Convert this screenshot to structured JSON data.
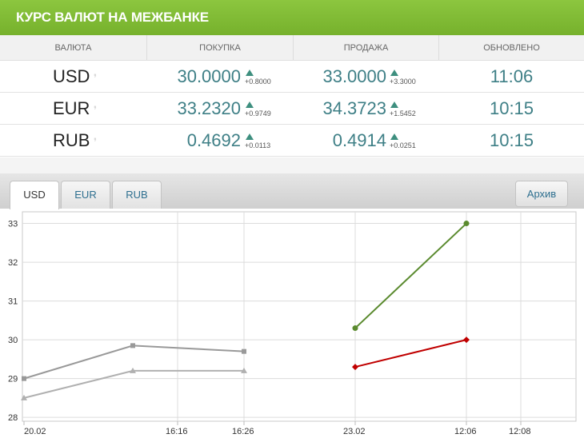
{
  "header": {
    "title": "КУРС ВАЛЮТ НА МЕЖБАНКЕ"
  },
  "table": {
    "headers": [
      "ВАЛЮТА",
      "ПОКУПКА",
      "ПРОДАЖА",
      "ОБНОВЛЕНО"
    ],
    "rows": [
      {
        "currency": "USD",
        "buy": "30.0000",
        "buy_delta": "+0.8000",
        "sell": "33.0000",
        "sell_delta": "+3.3000",
        "updated": "11:06"
      },
      {
        "currency": "EUR",
        "buy": "33.2320",
        "buy_delta": "+0.9749",
        "sell": "34.3723",
        "sell_delta": "+1.5452",
        "updated": "10:15"
      },
      {
        "currency": "RUB",
        "buy": "0.4692",
        "buy_delta": "+0.0113",
        "sell": "0.4914",
        "sell_delta": "+0.0251",
        "updated": "10:15"
      }
    ],
    "pin_icon": "pin-icon",
    "trend_icon": "triangle-up-icon",
    "accent_color": "#3e7f86"
  },
  "tabs": [
    {
      "label": "USD",
      "active": true
    },
    {
      "label": "EUR",
      "active": false
    },
    {
      "label": "RUB",
      "active": false
    }
  ],
  "archive_label": "Архив",
  "colors": {
    "header": "#7fbb33",
    "green_series": "#5a8a2e",
    "red_series": "#c00000",
    "gray_series": "#a0a0a0"
  },
  "chart_data": {
    "type": "line",
    "x_ticks": [
      "20.02",
      "16:16",
      "16:26",
      "23.02",
      "12:06",
      "12:08"
    ],
    "y_ticks": [
      28,
      29,
      30,
      31,
      32,
      33
    ],
    "ylim": [
      27.9,
      33.3
    ],
    "grid": true,
    "series": [
      {
        "color": "#999999",
        "marker": "square",
        "points": [
          [
            "20.02",
            29.0
          ],
          [
            "16:16-",
            29.85
          ],
          [
            "16:26",
            29.7
          ]
        ]
      },
      {
        "color": "#b0b0b0",
        "marker": "triangle",
        "points": [
          [
            "20.02",
            28.5
          ],
          [
            "16:16-",
            29.2
          ],
          [
            "16:26",
            29.2
          ]
        ]
      },
      {
        "color": "#5a8a2e",
        "marker": "circle",
        "points": [
          [
            "23.02",
            30.3
          ],
          [
            "12:06",
            33.0
          ]
        ]
      },
      {
        "color": "#c00000",
        "marker": "diamond",
        "points": [
          [
            "23.02",
            29.3
          ],
          [
            "12:06",
            30.0
          ]
        ]
      }
    ]
  }
}
